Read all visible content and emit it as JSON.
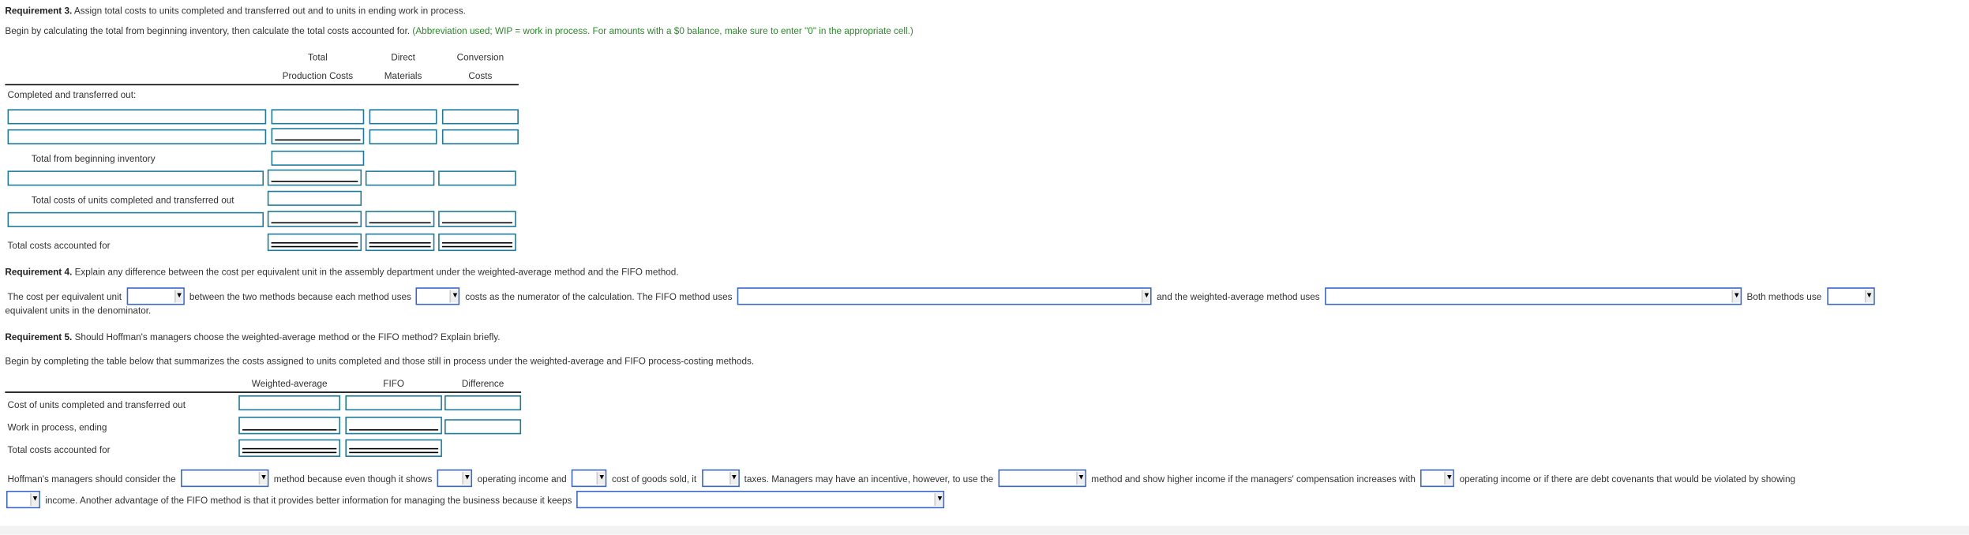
{
  "req3": {
    "title_bold": "Requirement 3.",
    "title_rest": " Assign total costs to units completed and transferred out and to units in ending work in process.",
    "instruction": "Begin by calculating the total from beginning inventory, then calculate the total costs accounted for.",
    "note": "(Abbreviation used; WIP = work in process. For amounts with a $0 balance, make sure to enter \"0\" in the appropriate cell.)",
    "headers": {
      "total_1": "Total",
      "total_2": "Production Costs",
      "dm_1": "Direct",
      "dm_2": "Materials",
      "cc_1": "Conversion",
      "cc_2": "Costs"
    },
    "labels": {
      "completed": "Completed and transferred out:",
      "total_beg_inv": "Total from beginning inventory",
      "total_completed": "Total costs of units completed and transferred out",
      "total_accounted": "Total costs accounted for"
    }
  },
  "req4": {
    "title_bold": "Requirement 4.",
    "title_rest": " Explain any difference between the cost per equivalent unit in the assembly department under the weighted-average method and the FIFO method.",
    "t1": "The cost per equivalent unit",
    "t2": "between the two methods because each method uses",
    "t3": "costs as the numerator of the calculation. The FIFO method uses",
    "t4": "and the weighted-average method uses",
    "t5": "Both methods use",
    "t6": "equivalent units in the denominator."
  },
  "req5": {
    "title_bold": "Requirement 5.",
    "title_rest": " Should Hoffman's managers choose the weighted-average method or the FIFO method? Explain briefly.",
    "instruction": "Begin by completing the table below that summarizes the costs assigned to units completed and those still in process under the weighted-average and FIFO process-costing methods.",
    "headers": {
      "wa": "Weighted-average",
      "fifo": "FIFO",
      "diff": "Difference"
    },
    "rows": [
      "Cost of units completed and transferred out",
      "Work in process, ending",
      "Total costs accounted for"
    ],
    "t1": "Hoffman's managers should consider the",
    "t2": "method because even though it shows",
    "t3": "operating income and",
    "t4": "cost of goods sold, it",
    "t5": "taxes. Managers may have an incentive, however, to use the",
    "t6": "method and show higher income if the managers' compensation increases with",
    "t7": "operating income or if there are debt covenants that would be violated by showing",
    "t8": "income. Another advantage of the FIFO method is that it provides better information for managing the business because it keeps"
  },
  "icons": {
    "dropdown": "triangle-down-icon"
  },
  "colors": {
    "input_border": "#1c7a9c",
    "dropdown_border": "#3a66cc",
    "note_green": "#2b8a2b"
  }
}
